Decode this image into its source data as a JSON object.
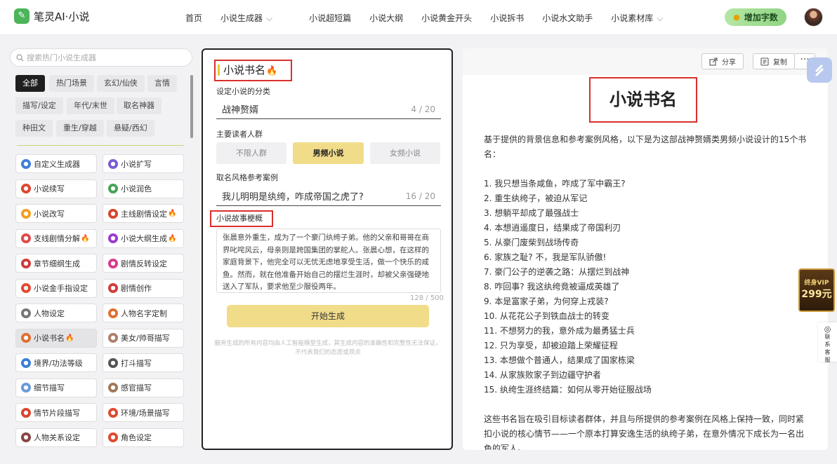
{
  "header": {
    "logo": "笔灵AI·小说",
    "nav": [
      "首页",
      "小说生成器",
      "小说超短篇",
      "小说大纲",
      "小说黄金开头",
      "小说拆书",
      "小说水文助手",
      "小说素材库"
    ],
    "add_words": "增加字数"
  },
  "sidebar": {
    "search_placeholder": "搜索热门小说生成器",
    "tags": [
      "全部",
      "热门场景",
      "玄幻/仙侠",
      "言情",
      "描写/设定",
      "年代/末世",
      "取名神器",
      "种田文",
      "重生/穿越",
      "悬疑/西幻"
    ],
    "tools": [
      {
        "label": "自定义生成器",
        "fire": false
      },
      {
        "label": "小说扩写",
        "fire": false
      },
      {
        "label": "小说续写",
        "fire": false
      },
      {
        "label": "小说润色",
        "fire": false
      },
      {
        "label": "小说改写",
        "fire": false
      },
      {
        "label": "主线剧情设定",
        "fire": true
      },
      {
        "label": "支线剧情分解",
        "fire": true
      },
      {
        "label": "小说大纲生成",
        "fire": true
      },
      {
        "label": "章节细纲生成",
        "fire": false
      },
      {
        "label": "剧情反转设定",
        "fire": false
      },
      {
        "label": "小说金手指设定",
        "fire": false
      },
      {
        "label": "剧情创作",
        "fire": false
      },
      {
        "label": "人物设定",
        "fire": false
      },
      {
        "label": "人物名字定制",
        "fire": false
      },
      {
        "label": "小说书名",
        "fire": true
      },
      {
        "label": "美女/帅哥描写",
        "fire": false
      },
      {
        "label": "境界/功法等级",
        "fire": false
      },
      {
        "label": "打斗描写",
        "fire": false
      },
      {
        "label": "细节描写",
        "fire": false
      },
      {
        "label": "感官描写",
        "fire": false
      },
      {
        "label": "情节片段描写",
        "fire": false
      },
      {
        "label": "环境/场景描写",
        "fire": false
      },
      {
        "label": "人物关系设定",
        "fire": false
      },
      {
        "label": "角色设定",
        "fire": false
      }
    ]
  },
  "form": {
    "title": "小说书名",
    "category_label": "设定小说的分类",
    "category_value": "战神赘婿",
    "category_count": "4 / 20",
    "audience_label": "主要读者人群",
    "audience": [
      "不限人群",
      "男频小说",
      "女频小说"
    ],
    "reference_label": "取名风格参考案例",
    "reference_value": "我儿明明是纨绔，咋成帝国之虎了?",
    "reference_count": "16 / 20",
    "story_label": "小说故事梗概",
    "story_value": "张晨意外重生，成为了一个豪门纨绔子弟。他的父亲和哥哥在商界叱咤风云，母亲则是跨国集团的掌舵人。张晨心想，在这样的家庭背景下，他完全可以无忧无虑地享受生活，做一个快乐的咸鱼。然而，就在他准备开始自己的摆烂生涯时，却被父亲强硬地送入了军队，要求他至少服役两年。",
    "story_count": "128 / 500",
    "generate": "开始生成",
    "disclaimer": "服务生成的所有内容均由人工智能模型生成，其生成内容的准确性和完整性无法保证，不代表我们的态度或观点"
  },
  "result": {
    "share": "分享",
    "copy": "复制",
    "more": "···",
    "title": "小说书名",
    "intro": "基于提供的背景信息和参考案例风格，以下是为这部战神赘婿类男频小说设计的15个书名：",
    "items": [
      "1. 我只想当条咸鱼，咋成了军中霸王?",
      "2. 重生纨绔子，被迫从军记",
      "3. 想躺平却成了最强战士",
      "4. 本想逍遥度日，结果成了帝国利刃",
      "5. 从豪门废柴到战场传奇",
      "6. 家族之耻? 不，我是军队骄傲!",
      "7. 豪门公子的逆袭之路：从摆烂到战神",
      "8. 咋回事? 我这纨绔竟被逼成英雄了",
      "9. 本是富家子弟，为何穿上戎装?",
      "10. 从花花公子到铁血战士的转变",
      "11. 不想努力的我，意外成为最勇猛士兵",
      "12. 只为享受，却被迫踏上荣耀征程",
      "13. 本想做个普通人，结果成了国家栋梁",
      "14. 从家族败家子到边疆守护者",
      "15. 纨绔生涯终结篇：如何从零开始征服战场"
    ],
    "outro": "这些书名旨在吸引目标读者群体，并且与所提供的参考案例在风格上保持一致，同时紧扣小说的核心情节——一个原本打算安逸生活的纨绔子弟，在意外情况下成长为一名出色的军人。"
  },
  "float": {
    "vip_line1": "终身VIP",
    "vip_line2": "299元",
    "contact": "联系客服"
  },
  "colors": {
    "accent_yellow": "#f1dc8a",
    "highlight_red": "#d9302c",
    "brand_green": "#4cb45a"
  }
}
